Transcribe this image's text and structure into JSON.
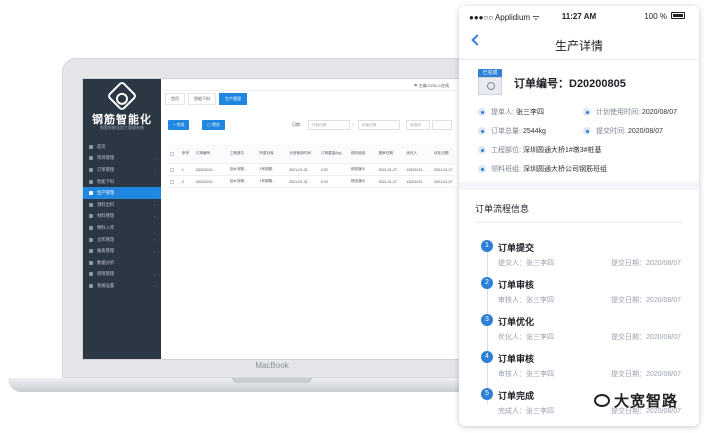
{
  "laptop": {
    "brand": "MacBook",
    "app": {
      "title": "钢筋智能化",
      "subtitle": "钢筋智能化加工管理系统",
      "user": "⚑ 主编JJZ50-1在线",
      "menu": [
        {
          "label": "首页",
          "active": false,
          "arrow": ""
        },
        {
          "label": "项目管理",
          "active": false,
          "arrow": "›"
        },
        {
          "label": "订单管理",
          "active": false,
          "arrow": "›"
        },
        {
          "label": "智能下料",
          "active": false,
          "arrow": ""
        },
        {
          "label": "生产管理",
          "active": true,
          "arrow": "›"
        },
        {
          "label": "领料出料",
          "active": false,
          "arrow": "›"
        },
        {
          "label": "材料管理",
          "active": false,
          "arrow": "›"
        },
        {
          "label": "物料入库",
          "active": false,
          "arrow": ""
        },
        {
          "label": "仓库管理",
          "active": false,
          "arrow": "›"
        },
        {
          "label": "报表管理",
          "active": false,
          "arrow": "›"
        },
        {
          "label": "数据分析",
          "active": false,
          "arrow": ""
        },
        {
          "label": "权限管理",
          "active": false,
          "arrow": "›"
        },
        {
          "label": "系统设置",
          "active": false,
          "arrow": "›"
        }
      ],
      "tabs": [
        {
          "label": "首页",
          "active": false
        },
        {
          "label": "智能下料",
          "active": false
        },
        {
          "label": "生产管理",
          "active": true
        }
      ],
      "toolbar": {
        "complete_label": "+ 完成",
        "print_label": "▢ 预览",
        "date_label": "日期",
        "date_start": "开始日期",
        "date_sep": "~",
        "date_end": "结束日期",
        "select_placeholder": "请选择",
        "search_label": "搜索"
      },
      "table": {
        "headers": [
          "序号",
          "订单编号",
          "工程部位",
          "所属仓库",
          "计划使用时间",
          "订单重量(kg)",
          "领料班组",
          "报审日期",
          "优化人",
          "优化日期"
        ],
        "rows": [
          [
            "1",
            "D2021012...",
            "自水河隧...",
            "1号钢筋...",
            "2021-01-31",
            "0.02",
            "领班演示",
            "2021-01-27",
            "12021012...",
            "2021-01-27"
          ],
          [
            "2",
            "D2021012...",
            "自水河隧...",
            "1号钢筋...",
            "2021-01-31",
            "0.02",
            "领班演示",
            "2021-01-27",
            "12021012...",
            "2021-01-27"
          ]
        ]
      }
    }
  },
  "phone": {
    "status": {
      "carrier": "●●●○○ Applidium ᯤ",
      "time": "11:27 AM",
      "battery": "100 %"
    },
    "title": "生产详情",
    "badge": "已完成",
    "order_no": "订单编号：D20200805",
    "info": {
      "applicant_label": "提单人:",
      "applicant": "张三李四",
      "plan_label": "计划使用时间:",
      "plan_date": "2020/08/07",
      "weight_label": "订单总量:",
      "weight": "2544kg",
      "submit_label": "提交时间:",
      "submit_date": "2020/08/07",
      "site_label": "工程部位:",
      "site": "深圳圆通大桥1#墩3#桩基",
      "team_label": "领料班组:",
      "team": "深圳圆通大桥公司钢筋班组"
    },
    "flow_title": "订单流程信息",
    "steps": [
      {
        "num": "1",
        "title": "订单提交",
        "person": "提交人：张三李四",
        "date": "提交日期：2020/08/07"
      },
      {
        "num": "2",
        "title": "订单审核",
        "person": "审核人：张三李四",
        "date": "提交日期：2020/08/07"
      },
      {
        "num": "3",
        "title": "订单优化",
        "person": "优化人：张三李四",
        "date": "提交日期：2020/08/07"
      },
      {
        "num": "4",
        "title": "订单审核",
        "person": "审核人：张三李四",
        "date": "提交日期：2020/08/07"
      },
      {
        "num": "5",
        "title": "订单完成",
        "person": "完成人：张三李四",
        "date": "提交日期：2020/08/07"
      }
    ]
  },
  "watermark": "大宽智路",
  "colors": {
    "accent": "#2e7fd6",
    "sidebar": "#2c3744",
    "active_menu": "#1f87e0"
  }
}
